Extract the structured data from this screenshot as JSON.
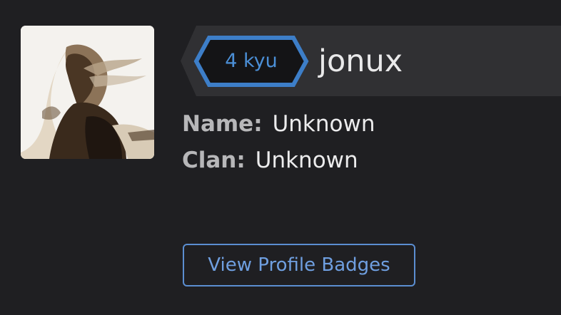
{
  "profile": {
    "avatar_alt": "user avatar",
    "rank": "4 kyu",
    "username": "jonux",
    "name_label": "Name:",
    "name_value": "Unknown",
    "clan_label": "Clan:",
    "clan_value": "Unknown",
    "badges_button_label": "View Profile Badges"
  },
  "colors": {
    "background": "#1f1f22",
    "banner": "#303033",
    "rank_blue": "#3d7ec8",
    "link_blue": "#6f9fe0"
  }
}
